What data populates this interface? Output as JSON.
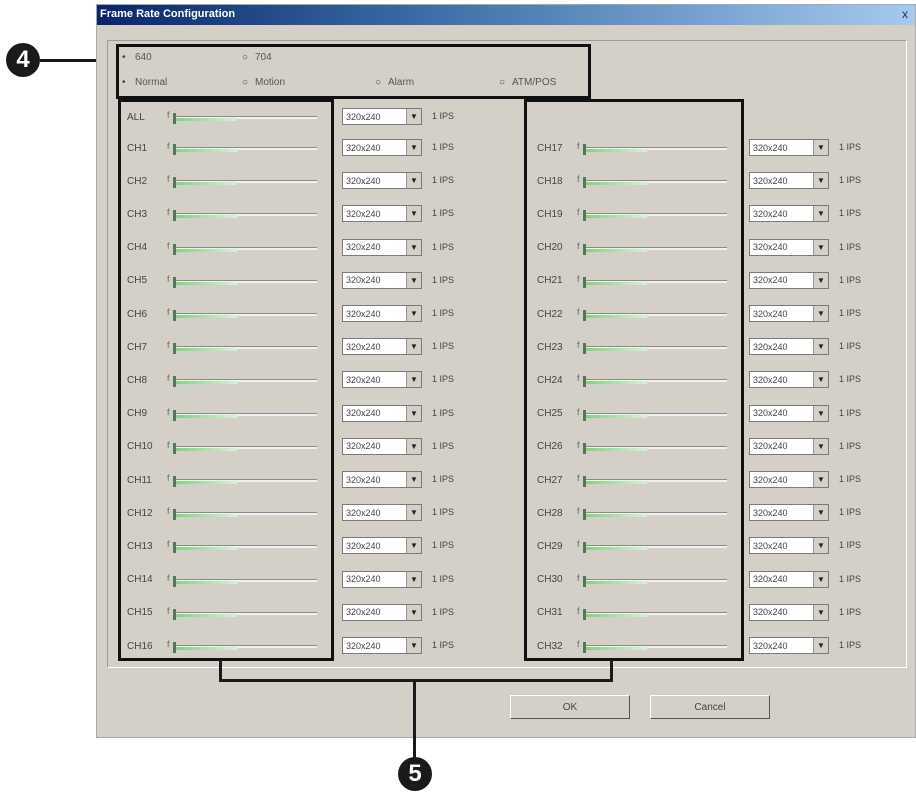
{
  "window": {
    "title": "Frame Rate Configuration",
    "close_glyph": "x"
  },
  "callouts": {
    "top": "4",
    "bottom": "5"
  },
  "resolution": {
    "options": [
      "640",
      "704"
    ],
    "selected": "640"
  },
  "mode": {
    "options": [
      "Normal",
      "Motion",
      "Alarm",
      "ATM/POS"
    ],
    "selected": "Normal"
  },
  "slider_tick": "f",
  "all_row": {
    "label": "ALL",
    "resolution": "320x240",
    "rate": "1 IPS"
  },
  "left_channels": [
    {
      "label": "CH1",
      "resolution": "320x240",
      "rate": "1 IPS"
    },
    {
      "label": "CH2",
      "resolution": "320x240",
      "rate": "1 IPS"
    },
    {
      "label": "CH3",
      "resolution": "320x240",
      "rate": "1 IPS"
    },
    {
      "label": "CH4",
      "resolution": "320x240",
      "rate": "1 IPS"
    },
    {
      "label": "CH5",
      "resolution": "320x240",
      "rate": "1 IPS"
    },
    {
      "label": "CH6",
      "resolution": "320x240",
      "rate": "1 IPS"
    },
    {
      "label": "CH7",
      "resolution": "320x240",
      "rate": "1 IPS"
    },
    {
      "label": "CH8",
      "resolution": "320x240",
      "rate": "1 IPS"
    },
    {
      "label": "CH9",
      "resolution": "320x240",
      "rate": "1 IPS"
    },
    {
      "label": "CH10",
      "resolution": "320x240",
      "rate": "1 IPS"
    },
    {
      "label": "CH11",
      "resolution": "320x240",
      "rate": "1 IPS"
    },
    {
      "label": "CH12",
      "resolution": "320x240",
      "rate": "1 IPS"
    },
    {
      "label": "CH13",
      "resolution": "320x240",
      "rate": "1 IPS"
    },
    {
      "label": "CH14",
      "resolution": "320x240",
      "rate": "1 IPS"
    },
    {
      "label": "CH15",
      "resolution": "320x240",
      "rate": "1 IPS"
    },
    {
      "label": "CH16",
      "resolution": "320x240",
      "rate": "1 IPS"
    }
  ],
  "right_channels": [
    {
      "label": "CH17",
      "resolution": "320x240",
      "rate": "1 IPS"
    },
    {
      "label": "CH18",
      "resolution": "320x240",
      "rate": "1 IPS"
    },
    {
      "label": "CH19",
      "resolution": "320x240",
      "rate": "1 IPS"
    },
    {
      "label": "CH20",
      "resolution": "320x240",
      "rate": "1 IPS"
    },
    {
      "label": "CH21",
      "resolution": "320x240",
      "rate": "1 IPS"
    },
    {
      "label": "CH22",
      "resolution": "320x240",
      "rate": "1 IPS"
    },
    {
      "label": "CH23",
      "resolution": "320x240",
      "rate": "1 IPS"
    },
    {
      "label": "CH24",
      "resolution": "320x240",
      "rate": "1 IPS"
    },
    {
      "label": "CH25",
      "resolution": "320x240",
      "rate": "1 IPS"
    },
    {
      "label": "CH26",
      "resolution": "320x240",
      "rate": "1 IPS"
    },
    {
      "label": "CH27",
      "resolution": "320x240",
      "rate": "1 IPS"
    },
    {
      "label": "CH28",
      "resolution": "320x240",
      "rate": "1 IPS"
    },
    {
      "label": "CH29",
      "resolution": "320x240",
      "rate": "1 IPS"
    },
    {
      "label": "CH30",
      "resolution": "320x240",
      "rate": "1 IPS"
    },
    {
      "label": "CH31",
      "resolution": "320x240",
      "rate": "1 IPS"
    },
    {
      "label": "CH32",
      "resolution": "320x240",
      "rate": "1 IPS"
    }
  ],
  "buttons": {
    "ok": "OK",
    "cancel": "Cancel"
  },
  "colors": {
    "slider_fill": "#7fd07f",
    "titlebar": "#0a246a",
    "dialog_bg": "#d4d0c8"
  }
}
